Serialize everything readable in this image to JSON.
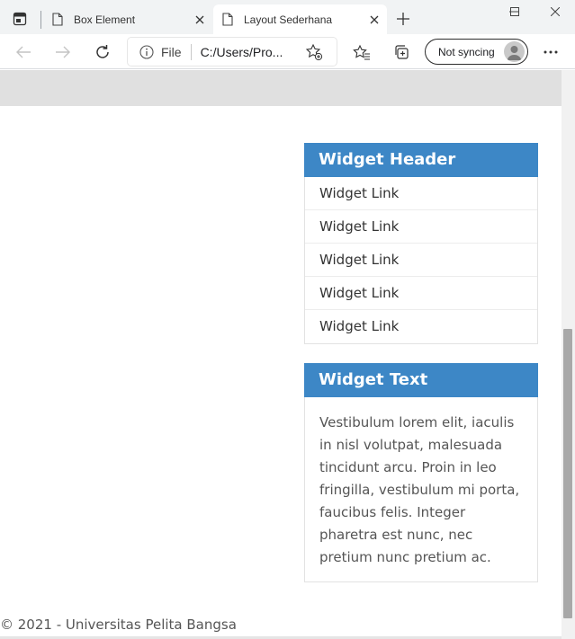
{
  "browser": {
    "tabs": [
      {
        "title": "Box Element",
        "active": false
      },
      {
        "title": "Layout Sederhana",
        "active": true
      }
    ],
    "address": {
      "scheme": "File",
      "url": "C:/Users/Pro..."
    },
    "sync_label": "Not syncing"
  },
  "page": {
    "widget_links": {
      "header": "Widget Header",
      "items": [
        "Widget Link",
        "Widget Link",
        "Widget Link",
        "Widget Link",
        "Widget Link"
      ]
    },
    "widget_text": {
      "header": "Widget Text",
      "lines": [
        "Vestibulum lorem elit, iaculis",
        "in nisl volutpat, malesuada",
        "tincidunt arcu. Proin in leo",
        "fringilla, vestibulum mi porta,",
        "faucibus felis. Integer",
        "pharetra est nunc, nec",
        "pretium nunc pretium ac."
      ]
    },
    "footer": "© 2021 - Universitas Pelita Bangsa"
  },
  "colors": {
    "widget_header_bg": "#3d87c6",
    "page_header_strip": "#e0e0e0"
  }
}
